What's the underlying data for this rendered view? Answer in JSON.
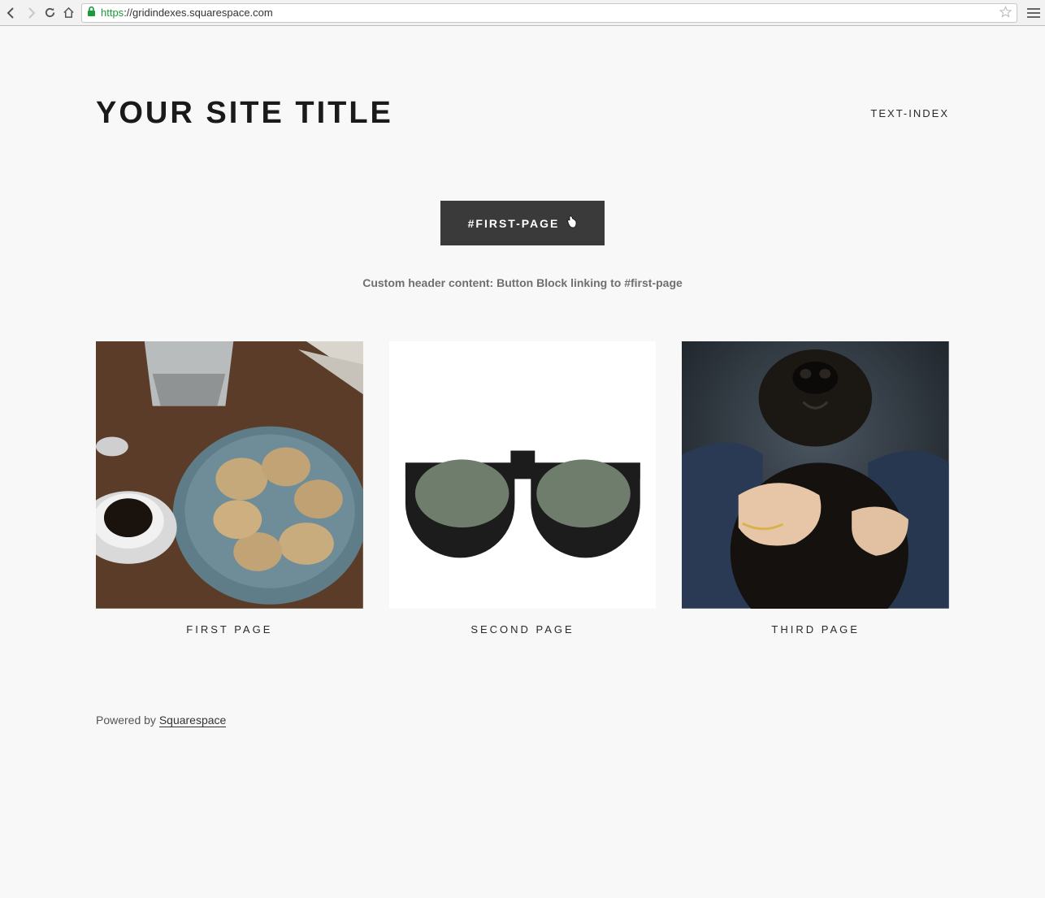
{
  "browser": {
    "url_scheme": "https",
    "url_rest": "://gridindexes.squarespace.com"
  },
  "header": {
    "site_title": "YOUR SITE TITLE",
    "nav_link": "TEXT-INDEX"
  },
  "hero": {
    "button_label": "#FIRST-PAGE",
    "caption": "Custom header content: Button Block linking to #first-page"
  },
  "grid": {
    "items": [
      {
        "label": "FIRST PAGE",
        "image_desc": "coffee-and-cookies"
      },
      {
        "label": "SECOND PAGE",
        "image_desc": "sunglasses"
      },
      {
        "label": "THIRD PAGE",
        "image_desc": "dog-portrait"
      }
    ]
  },
  "footer": {
    "prefix": "Powered by ",
    "brand": "Squarespace"
  }
}
